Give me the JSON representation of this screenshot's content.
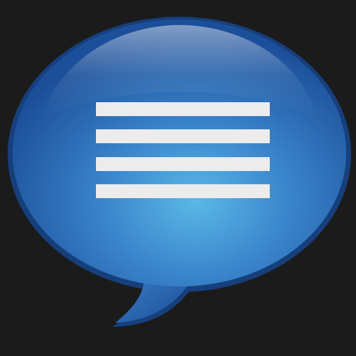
{
  "app_icon": {
    "icon": "speech-bubble-message-icon",
    "glyph": "text-lines-icon",
    "line_count": 4,
    "colors": {
      "background": "#1b1b1b",
      "bubble_center": "#5ab8e6",
      "bubble_mid": "#3a85cc",
      "bubble_edge": "#1c4f99",
      "bubble_rim": "#163f7c",
      "lines": "#ececec"
    }
  }
}
